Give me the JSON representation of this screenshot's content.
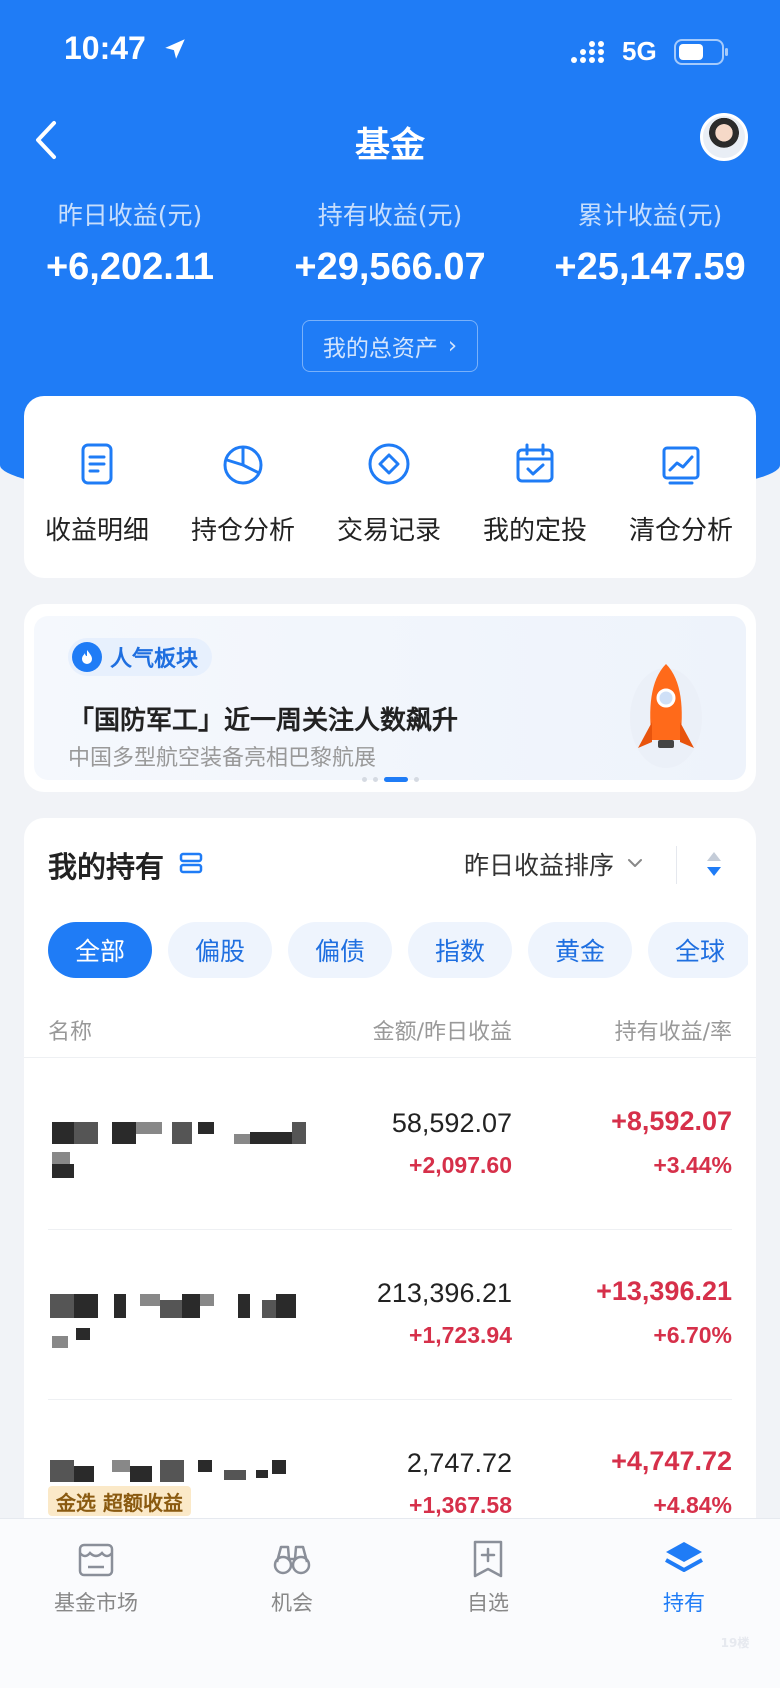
{
  "status_bar": {
    "time": "10:47",
    "network": "5G"
  },
  "nav": {
    "title": "基金"
  },
  "stats": [
    {
      "label": "昨日收益(元)",
      "value": "+6,202.11"
    },
    {
      "label": "持有收益(元)",
      "value": "+29,566.07"
    },
    {
      "label": "累计收益(元)",
      "value": "+25,147.59"
    }
  ],
  "total_assets": {
    "label": "我的总资产",
    "chevron": "›"
  },
  "tools": [
    {
      "label": "收益明细",
      "icon": "document-icon"
    },
    {
      "label": "持仓分析",
      "icon": "pie-chart-icon"
    },
    {
      "label": "交易记录",
      "icon": "diamond-circle-icon"
    },
    {
      "label": "我的定投",
      "icon": "calendar-check-icon"
    },
    {
      "label": "清仓分析",
      "icon": "trend-chart-icon"
    }
  ],
  "banner": {
    "tag": "人气板块",
    "title": "「国防军工」近一周关注人数飙升",
    "subtitle": "中国多型航空装备亮相巴黎航展",
    "active_slide": 3,
    "slide_count": 4
  },
  "holdings": {
    "title": "我的持有",
    "sort_label": "昨日收益排序",
    "chips": [
      "全部",
      "偏股",
      "偏债",
      "指数",
      "黄金",
      "全球"
    ],
    "active_chip": "全部",
    "columns": {
      "name": "名称",
      "amount": "金额/昨日收益",
      "profit": "持有收益/率"
    },
    "rows": [
      {
        "amount": "58,592.07",
        "daily": "+2,097.60",
        "profit": "+8,592.07",
        "rate": "+3.44%",
        "badge": ""
      },
      {
        "amount": "213,396.21",
        "daily": "+1,723.94",
        "profit": "+13,396.21",
        "rate": "+6.70%",
        "badge": ""
      },
      {
        "amount": "2,747.72",
        "daily": "+1,367.58",
        "profit": "+4,747.72",
        "rate": "+4.84%",
        "badge": "金选 超额收益"
      }
    ]
  },
  "tabbar": [
    {
      "label": "基金市场",
      "icon": "store-icon"
    },
    {
      "label": "机会",
      "icon": "binoculars-icon"
    },
    {
      "label": "自选",
      "icon": "bookmark-add-icon"
    },
    {
      "label": "持有",
      "icon": "layers-icon"
    }
  ],
  "active_tab": "持有",
  "watermark": "19楼",
  "colors": {
    "brand_blue": "#1f7cf6",
    "profit_red": "#d6304a",
    "page_bg": "#f1f3f7"
  }
}
